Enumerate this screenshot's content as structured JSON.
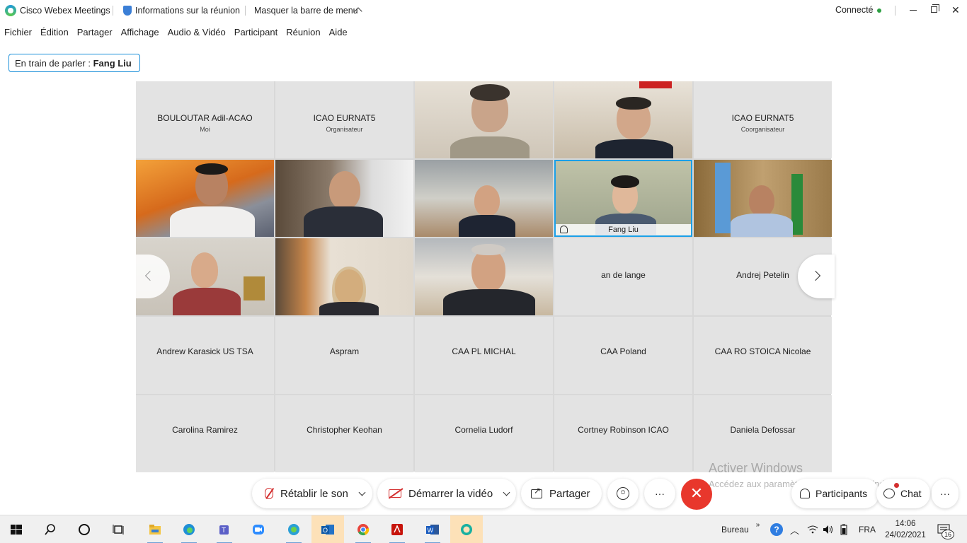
{
  "titlebar": {
    "app": "Cisco Webex Meetings",
    "info": "Informations sur la réunion",
    "hide_menu": "Masquer la barre de menu",
    "status": "Connecté"
  },
  "menu": [
    "Fichier",
    "Édition",
    "Partager",
    "Affichage",
    "Audio & Vidéo",
    "Participant",
    "Réunion",
    "Aide"
  ],
  "speaking": {
    "prefix": "En train de parler :",
    "name": "Fang Liu"
  },
  "tiles": [
    {
      "name": "BOULOUTAR Adil-ACAO",
      "role": "Moi"
    },
    {
      "name": "ICAO EURNAT5",
      "role": "Organisateur"
    },
    {
      "name": "",
      "role": ""
    },
    {
      "name": "",
      "role": ""
    },
    {
      "name": "ICAO EURNAT5",
      "role": "Coorganisateur"
    },
    {
      "name": "",
      "role": ""
    },
    {
      "name": "",
      "role": ""
    },
    {
      "name": "",
      "role": ""
    },
    {
      "name": "Fang Liu",
      "role": ""
    },
    {
      "name": "",
      "role": ""
    },
    {
      "name": "",
      "role": ""
    },
    {
      "name": "",
      "role": ""
    },
    {
      "name": "",
      "role": ""
    },
    {
      "name": "an de lange",
      "role": ""
    },
    {
      "name": "Andrej Petelin",
      "role": ""
    },
    {
      "name": "Andrew Karasick US TSA",
      "role": ""
    },
    {
      "name": "Aspram",
      "role": ""
    },
    {
      "name": "CAA PL MICHAL",
      "role": ""
    },
    {
      "name": "CAA Poland",
      "role": ""
    },
    {
      "name": "CAA RO STOICA Nicolae",
      "role": ""
    },
    {
      "name": "Carolina Ramirez",
      "role": ""
    },
    {
      "name": "Christopher Keohan",
      "role": ""
    },
    {
      "name": "Cornelia Ludorf",
      "role": ""
    },
    {
      "name": "Cortney Robinson ICAO",
      "role": ""
    },
    {
      "name": "Daniela Defossar",
      "role": ""
    }
  ],
  "controls": {
    "unmute": "Rétablir le son",
    "video": "Démarrer la vidéo",
    "share": "Partager",
    "more": "···",
    "end": "✕",
    "participants": "Participants",
    "chat": "Chat"
  },
  "watermark": {
    "title": "Activer Windows",
    "subtitle": "Accédez aux paramètres pour activer Windows."
  },
  "taskbar": {
    "desktop_label": "Bureau",
    "lang": "FRA",
    "time": "14:06",
    "date": "24/02/2021",
    "notif_count": "16",
    "help": "?"
  }
}
